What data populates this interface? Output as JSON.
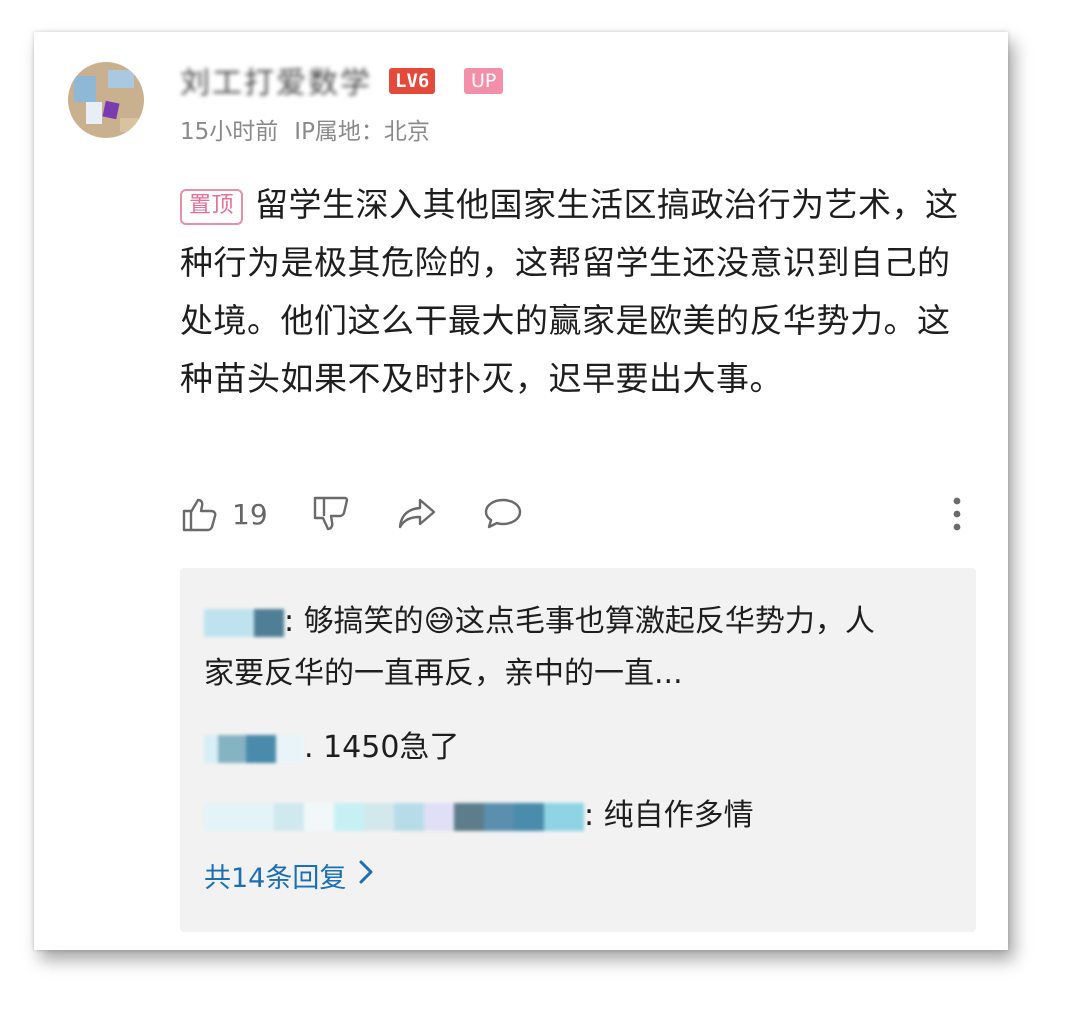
{
  "comment": {
    "username": "刘工打爱数学",
    "level_badge": "LV6",
    "up_badge": "UP",
    "time": "15小时前",
    "location": "IP属地：北京",
    "pin_label": "置顶",
    "text": "留学生深入其他国家生活区搞政治行为艺术，这种行为是极其危险的，这帮留学生还没意识到自己的处境。他们这么干最大的赢家是欧美的反华势力。这种苗头如果不及时扑灭，迟早要出大事。"
  },
  "actions": {
    "like_count": "19",
    "icons": [
      "thumbs-up-icon",
      "thumbs-down-icon",
      "share-icon",
      "comment-icon",
      "more-icon"
    ]
  },
  "replies": [
    {
      "text": ": 够搞笑的😅这点毛事也算激起反华势力，人家要反华的一直再反，亲中的一直..."
    },
    {
      "text": ". 1450急了"
    },
    {
      "text": ": 纯自作多情"
    }
  ],
  "see_all": "共14条回复",
  "colors": {
    "level_badge": "#e5493a",
    "up_badge": "#f38fa9",
    "pin": "#e66f92",
    "link": "#1a6fb5",
    "reply_bg": "#f2f2f2"
  }
}
